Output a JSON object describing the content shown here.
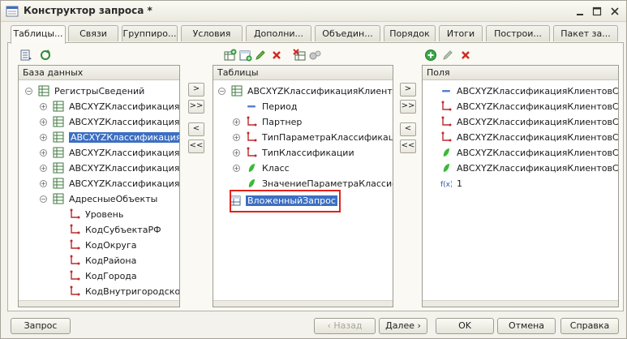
{
  "window": {
    "title": "Конструктор запроса *"
  },
  "tabs": [
    {
      "label": "Таблицы...",
      "active": true
    },
    {
      "label": "Связи"
    },
    {
      "label": "Группиро..."
    },
    {
      "label": "Условия"
    },
    {
      "label": "Дополни..."
    },
    {
      "label": "Объедин..."
    },
    {
      "label": "Порядок"
    },
    {
      "label": "Итоги"
    },
    {
      "label": "Построи..."
    },
    {
      "label": "Пакет за..."
    }
  ],
  "left_panel": {
    "header": "База данных",
    "items": [
      {
        "label": "РегистрыСведений",
        "icon": "register-icon"
      },
      {
        "label": "ABCXYZКлассификацияКл",
        "icon": "table-icon"
      },
      {
        "label": "ABCXYZКлассификацияКл",
        "icon": "table-icon"
      },
      {
        "label": "ABCXYZКлассификацияКл",
        "icon": "table-icon",
        "selected": true
      },
      {
        "label": "ABCXYZКлассификацияНо",
        "icon": "table-icon"
      },
      {
        "label": "ABCXYZКлассификацияНо",
        "icon": "table-icon"
      },
      {
        "label": "ABCXYZКлассификацияНо",
        "icon": "table-icon"
      },
      {
        "label": "АдресныеОбъекты",
        "icon": "table-icon"
      },
      {
        "label": "Уровень",
        "icon": "dimension-icon"
      },
      {
        "label": "КодСубъектаРФ",
        "icon": "dimension-icon"
      },
      {
        "label": "КодОкруга",
        "icon": "dimension-icon"
      },
      {
        "label": "КодРайона",
        "icon": "dimension-icon"
      },
      {
        "label": "КодГорода",
        "icon": "dimension-icon"
      },
      {
        "label": "КодВнутригородскогоР",
        "icon": "dimension-icon"
      }
    ]
  },
  "middle_panel": {
    "header": "Таблицы",
    "items": [
      {
        "label": "ABCXYZКлассификацияКлиенто",
        "icon": "table-icon"
      },
      {
        "label": "Период",
        "icon": "period-icon"
      },
      {
        "label": "Партнер",
        "icon": "dimension-icon"
      },
      {
        "label": "ТипПараметраКлассификац",
        "icon": "dimension-icon"
      },
      {
        "label": "ТипКлассификации",
        "icon": "dimension-icon"
      },
      {
        "label": "Класс",
        "icon": "resource-icon"
      },
      {
        "label": "ЗначениеПараметраКлассиф",
        "icon": "resource-icon"
      },
      {
        "label": "ВложенныйЗапрос",
        "icon": "subquery-icon",
        "selected": true
      }
    ]
  },
  "right_panel": {
    "header": "Поля",
    "items": [
      {
        "label": "ABCXYZКлассификацияКлиентовСре",
        "icon": "period-icon"
      },
      {
        "label": "ABCXYZКлассификацияКлиентовСре",
        "icon": "dimension-icon"
      },
      {
        "label": "ABCXYZКлассификацияКлиентовСре",
        "icon": "dimension-icon"
      },
      {
        "label": "ABCXYZКлассификацияКлиентовСре",
        "icon": "dimension-icon"
      },
      {
        "label": "ABCXYZКлассификацияКлиентовСре",
        "icon": "resource-icon"
      },
      {
        "label": "ABCXYZКлассификацияКлиентовСре",
        "icon": "resource-icon"
      },
      {
        "label": "1",
        "icon": "expression-icon"
      }
    ]
  },
  "middle_buttons": [
    ">",
    ">>",
    "<",
    "<<"
  ],
  "right_buttons": [
    ">",
    ">>",
    "<",
    "<<"
  ],
  "bottom": {
    "query": "Запрос",
    "back": "‹ Назад",
    "next": "Далее ›",
    "ok": "OK",
    "cancel": "Отмена",
    "help": "Справка"
  },
  "colors": {
    "selection": "#3d6fc2",
    "highlight_box": "#e0221b"
  }
}
